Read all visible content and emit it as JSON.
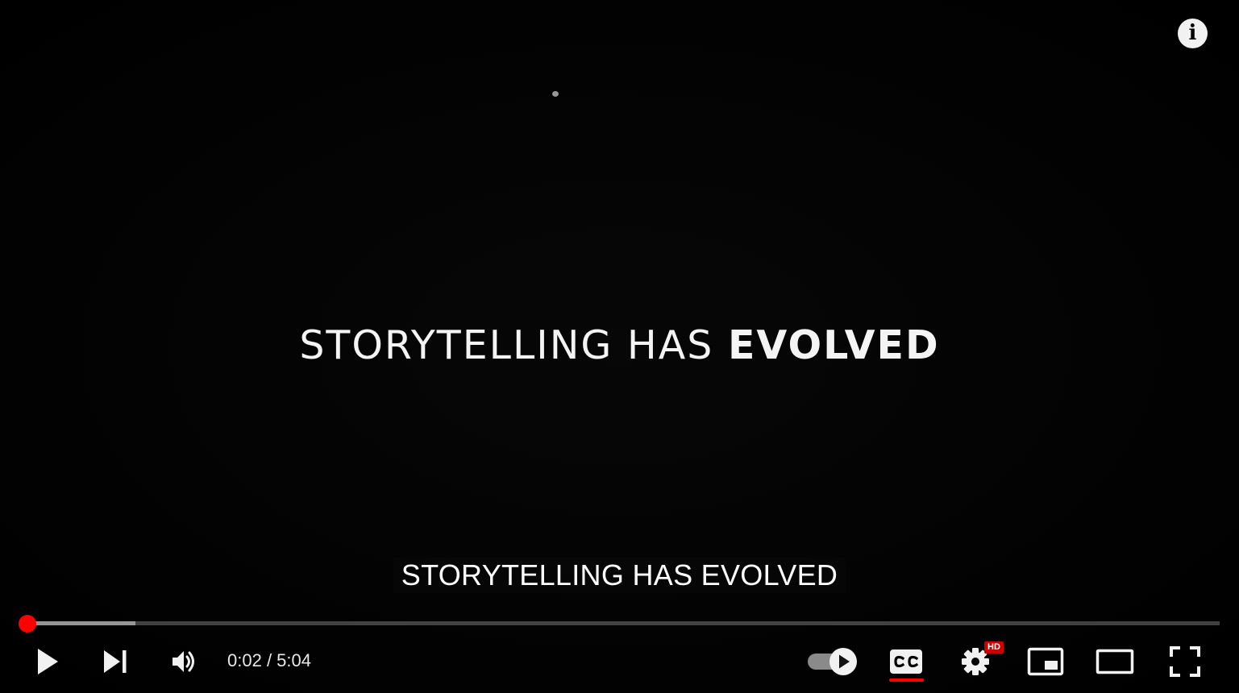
{
  "video": {
    "title_card_main": "STORYTELLING HAS",
    "title_card_emphasis": "EVOLVED"
  },
  "captions": {
    "text": "STORYTELLING HAS EVOLVED"
  },
  "info": {
    "glyph": "i"
  },
  "progress": {
    "played_fraction": 0.007,
    "loaded_fraction": 0.097
  },
  "controls": {
    "current_time": "0:02",
    "separator": " / ",
    "duration": "5:04",
    "hd_badge": "HD",
    "icons": {
      "play": "play-icon",
      "next": "skip-next-icon",
      "volume": "volume-icon",
      "autoplay": "autoplay-toggle-icon",
      "captions": "closed-captions-icon",
      "settings": "gear-icon",
      "miniplayer": "miniplayer-icon",
      "theater": "theater-mode-icon",
      "fullscreen": "fullscreen-icon"
    }
  },
  "colors": {
    "accent": "#ff0000",
    "hd": "#cc0000",
    "text": "#ffffff"
  }
}
